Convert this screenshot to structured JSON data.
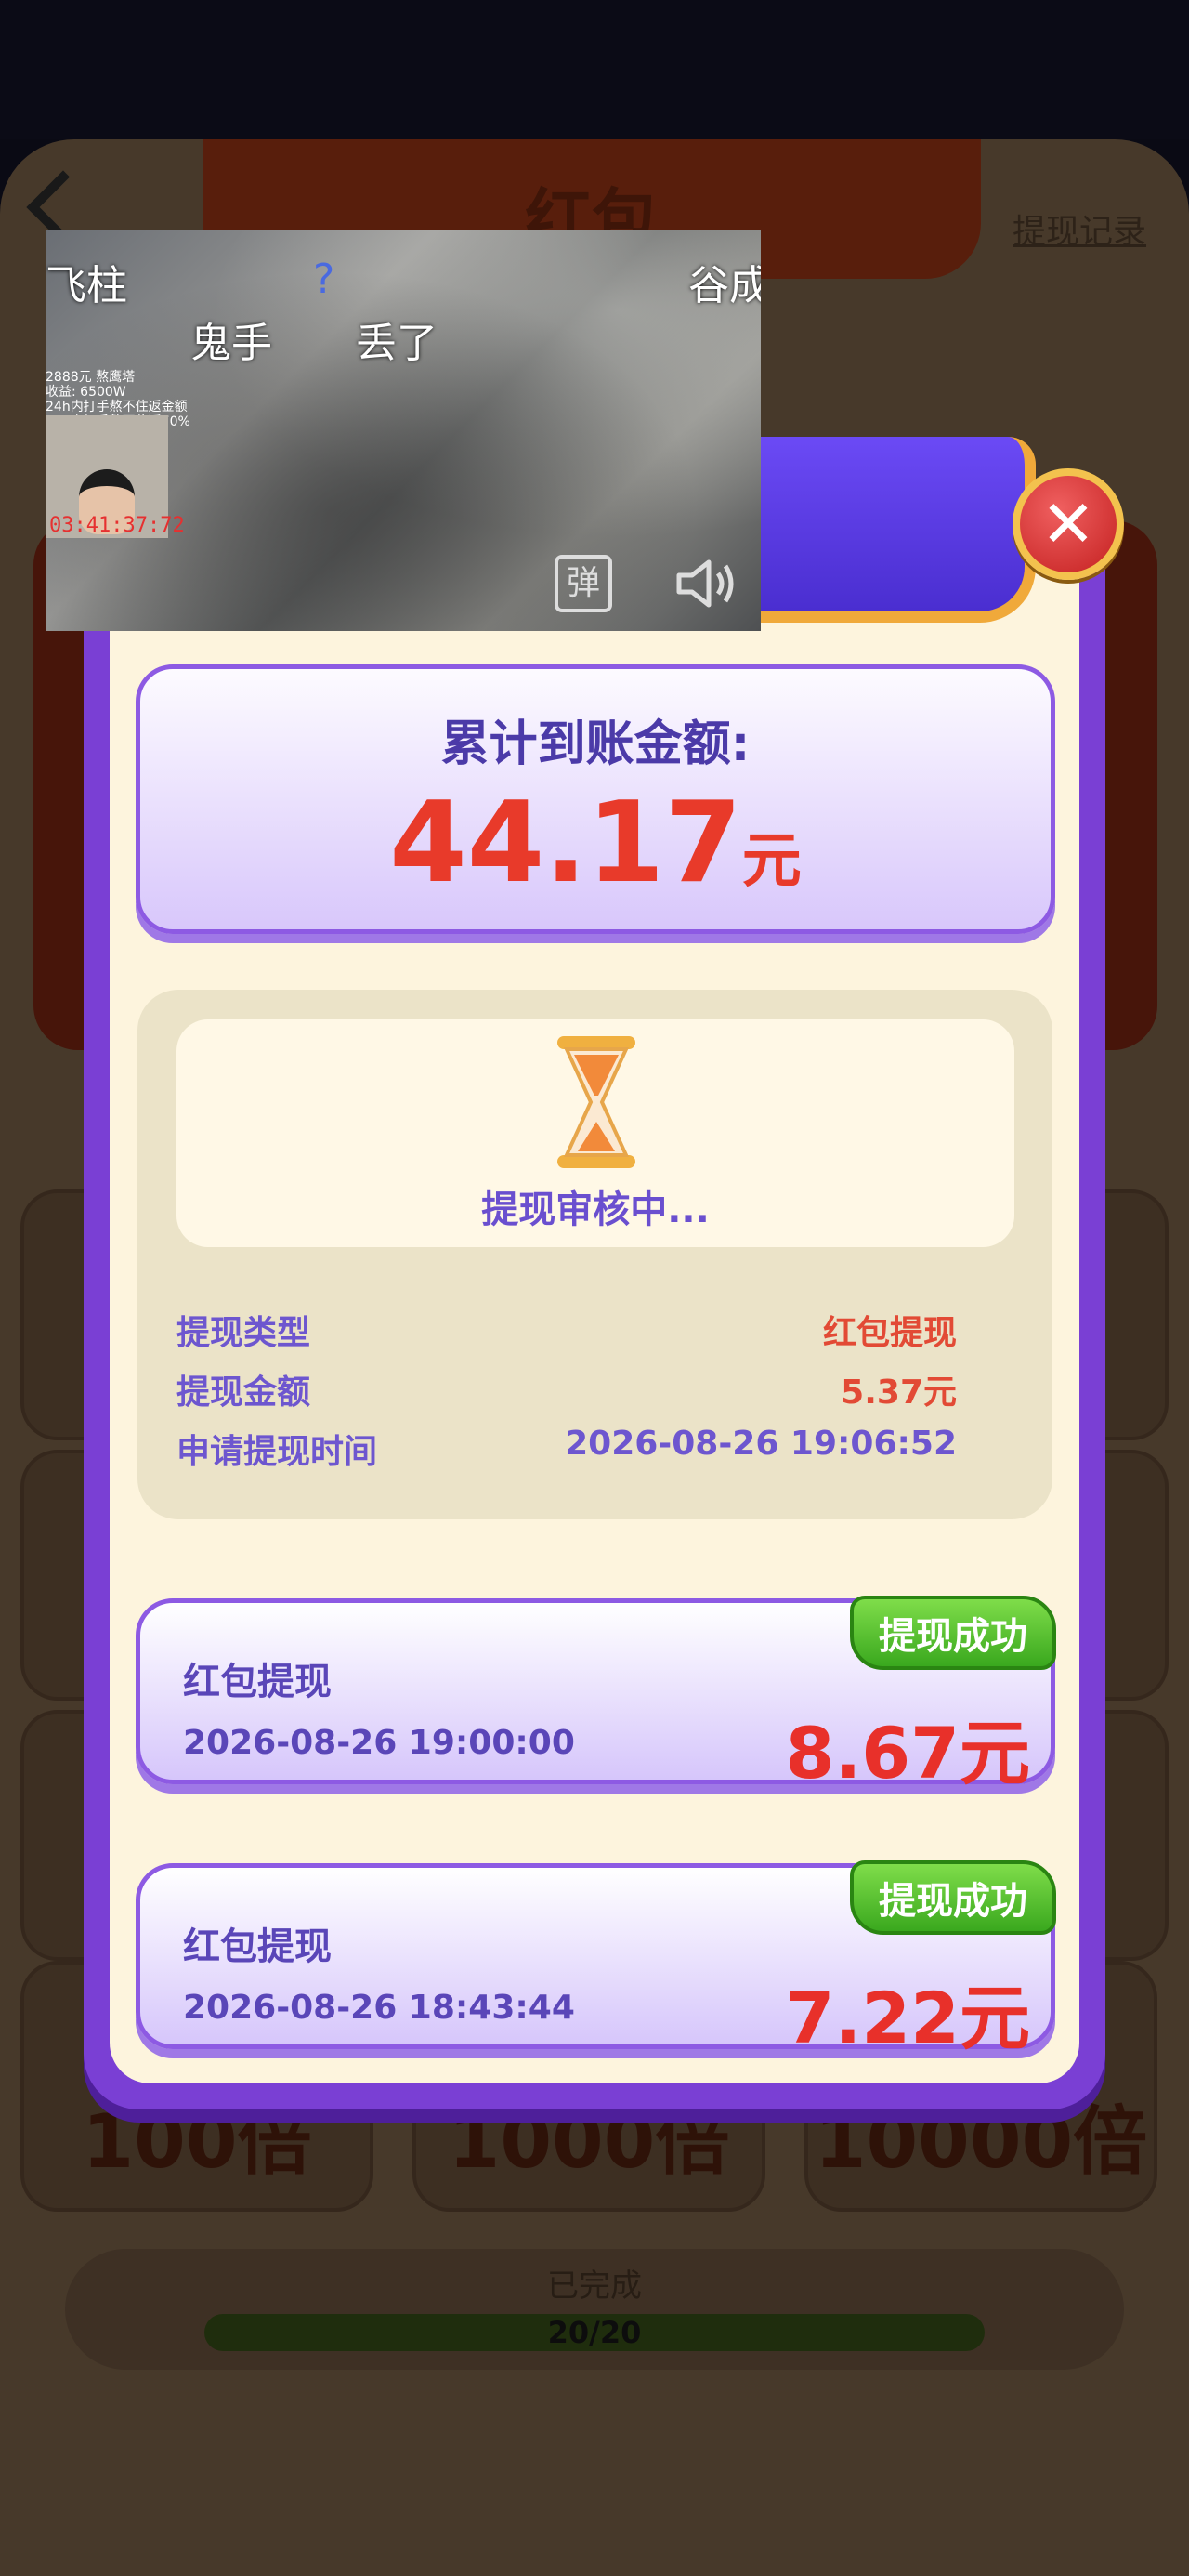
{
  "background": {
    "title": "红包",
    "record_link": "提现记录",
    "multipliers": [
      "100倍",
      "1000倍",
      "10000倍"
    ],
    "done_label": "已完成",
    "progress": "20/20"
  },
  "modal": {
    "total_label": "累计到账金额:",
    "total_amount": "44.17",
    "total_unit": "元",
    "review": {
      "status": "提现审核中...",
      "rows": [
        {
          "key": "提现类型",
          "value": "红包提现"
        },
        {
          "key": "提现金额",
          "value": "5.37元"
        },
        {
          "key": "申请提现时间",
          "value": "2026-08-26 19:06:52"
        }
      ]
    },
    "records": [
      {
        "type": "红包提现",
        "time": "2026-08-26 19:00:00",
        "amount": "8.67元",
        "badge": "提现成功"
      },
      {
        "type": "红包提现",
        "time": "2026-08-26 18:43:44",
        "amount": "7.22元",
        "badge": "提现成功"
      }
    ],
    "close_icon": "close-icon"
  },
  "video_overlay": {
    "top_left": "飞柱",
    "question": "?",
    "top_right": "谷成",
    "line2_a": "鬼手",
    "line2_b": "丢了",
    "line2_c": "",
    "stats": [
      "2888元 熬鹰塔",
      "收益: 6500W",
      "24h内打手熬不住返金额",
      "24h内打手熬不住返70%"
    ],
    "clock": "03:41:37:72",
    "danmu_button": "弹",
    "sound_icon": "speaker-icon"
  }
}
